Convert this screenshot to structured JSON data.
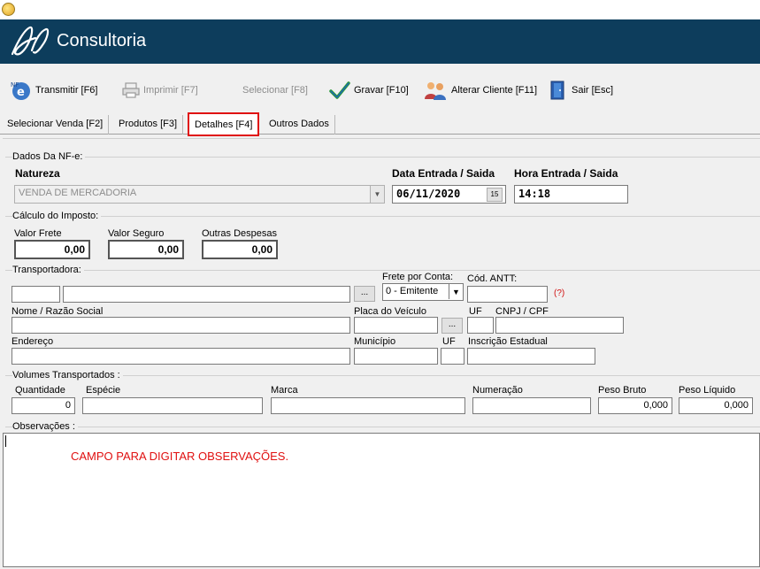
{
  "brand": "Consultoria",
  "toolbar": {
    "transmitir": "Transmitir [F6]",
    "imprimir": "Imprimir  [F7]",
    "selecionar": "Selecionar [F8]",
    "gravar": "Gravar [F10]",
    "alterar_cliente": "Alterar Cliente [F11]",
    "sair": "Sair   [Esc]"
  },
  "tabs": [
    {
      "label": "Selecionar Venda [F2]"
    },
    {
      "label": "Produtos [F3]"
    },
    {
      "label": "Detalhes [F4]"
    },
    {
      "label": "Outros Dados"
    }
  ],
  "nfe": {
    "group": "Dados Da NF-e:",
    "natureza_label": "Natureza",
    "natureza_value": "VENDA DE MERCADORIA",
    "data_label": "Data Entrada / Saida",
    "data_value": "06/11/2020",
    "hora_label": "Hora Entrada / Saida",
    "hora_value": "14:18",
    "calendar_glyph": "15"
  },
  "imposto": {
    "group": "Cálculo do Imposto:",
    "frete_label": "Valor Frete",
    "frete_value": "0,00",
    "seguro_label": "Valor Seguro",
    "seguro_value": "0,00",
    "outras_label": "Outras Despesas",
    "outras_value": "0,00"
  },
  "transportadora": {
    "group": "Transportadora:",
    "browse": "...",
    "frete_conta_label": "Frete por Conta:",
    "frete_conta_value": "0 - Emitente",
    "antt_label": "Cód. ANTT:",
    "antt_help": "(?)",
    "nome_label": "Nome / Razão Social",
    "placa_label": "Placa do Veículo",
    "uf_label": "UF",
    "cnpj_label": "CNPJ / CPF",
    "endereco_label": "Endereço",
    "municipio_label": "Município",
    "uf2_label": "UF",
    "ie_label": "Inscrição Estadual"
  },
  "volumes": {
    "group": "Volumes Transportados :",
    "quantidade_label": "Quantidade",
    "quantidade_value": "0",
    "especie_label": "Espécie",
    "marca_label": "Marca",
    "numeracao_label": "Numeração",
    "peso_bruto_label": "Peso Bruto",
    "peso_bruto_value": "0,000",
    "peso_liquido_label": "Peso Líquido",
    "peso_liquido_value": "0,000"
  },
  "observacoes": {
    "group": "Observações :",
    "text": "CAMPO PARA DIGITAR OBSERVAÇÕES."
  }
}
